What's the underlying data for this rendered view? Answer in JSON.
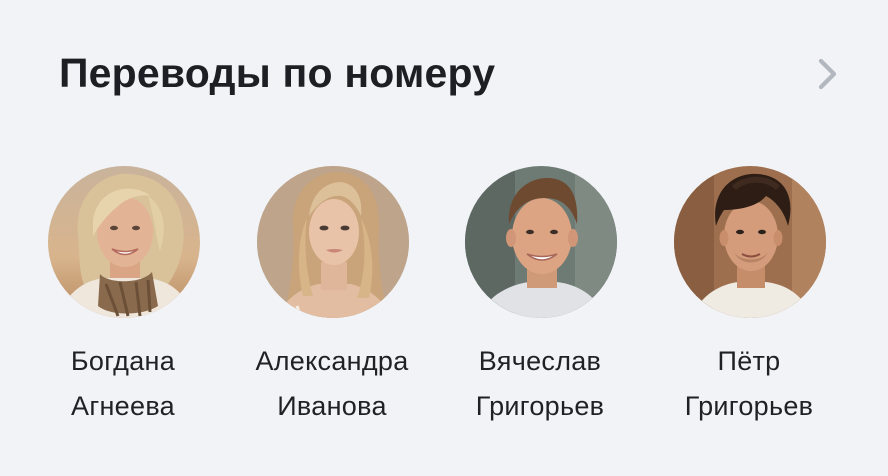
{
  "section": {
    "title": "Переводы по номеру",
    "more_icon": "chevron-right-icon"
  },
  "contacts": [
    {
      "first_name": "Богдана",
      "last_name": "Агнеева",
      "avatar": "avatar-photo"
    },
    {
      "first_name": "Александра",
      "last_name": "Иванова",
      "avatar": "avatar-photo"
    },
    {
      "first_name": "Вячеслав",
      "last_name": "Григорьев",
      "avatar": "avatar-photo"
    },
    {
      "first_name": "Пётр",
      "last_name": "Григорьев",
      "avatar": "avatar-photo"
    }
  ],
  "colors": {
    "background": "#f1f3f6",
    "text": "#1d1f24",
    "chevron": "#b3b7bf"
  }
}
